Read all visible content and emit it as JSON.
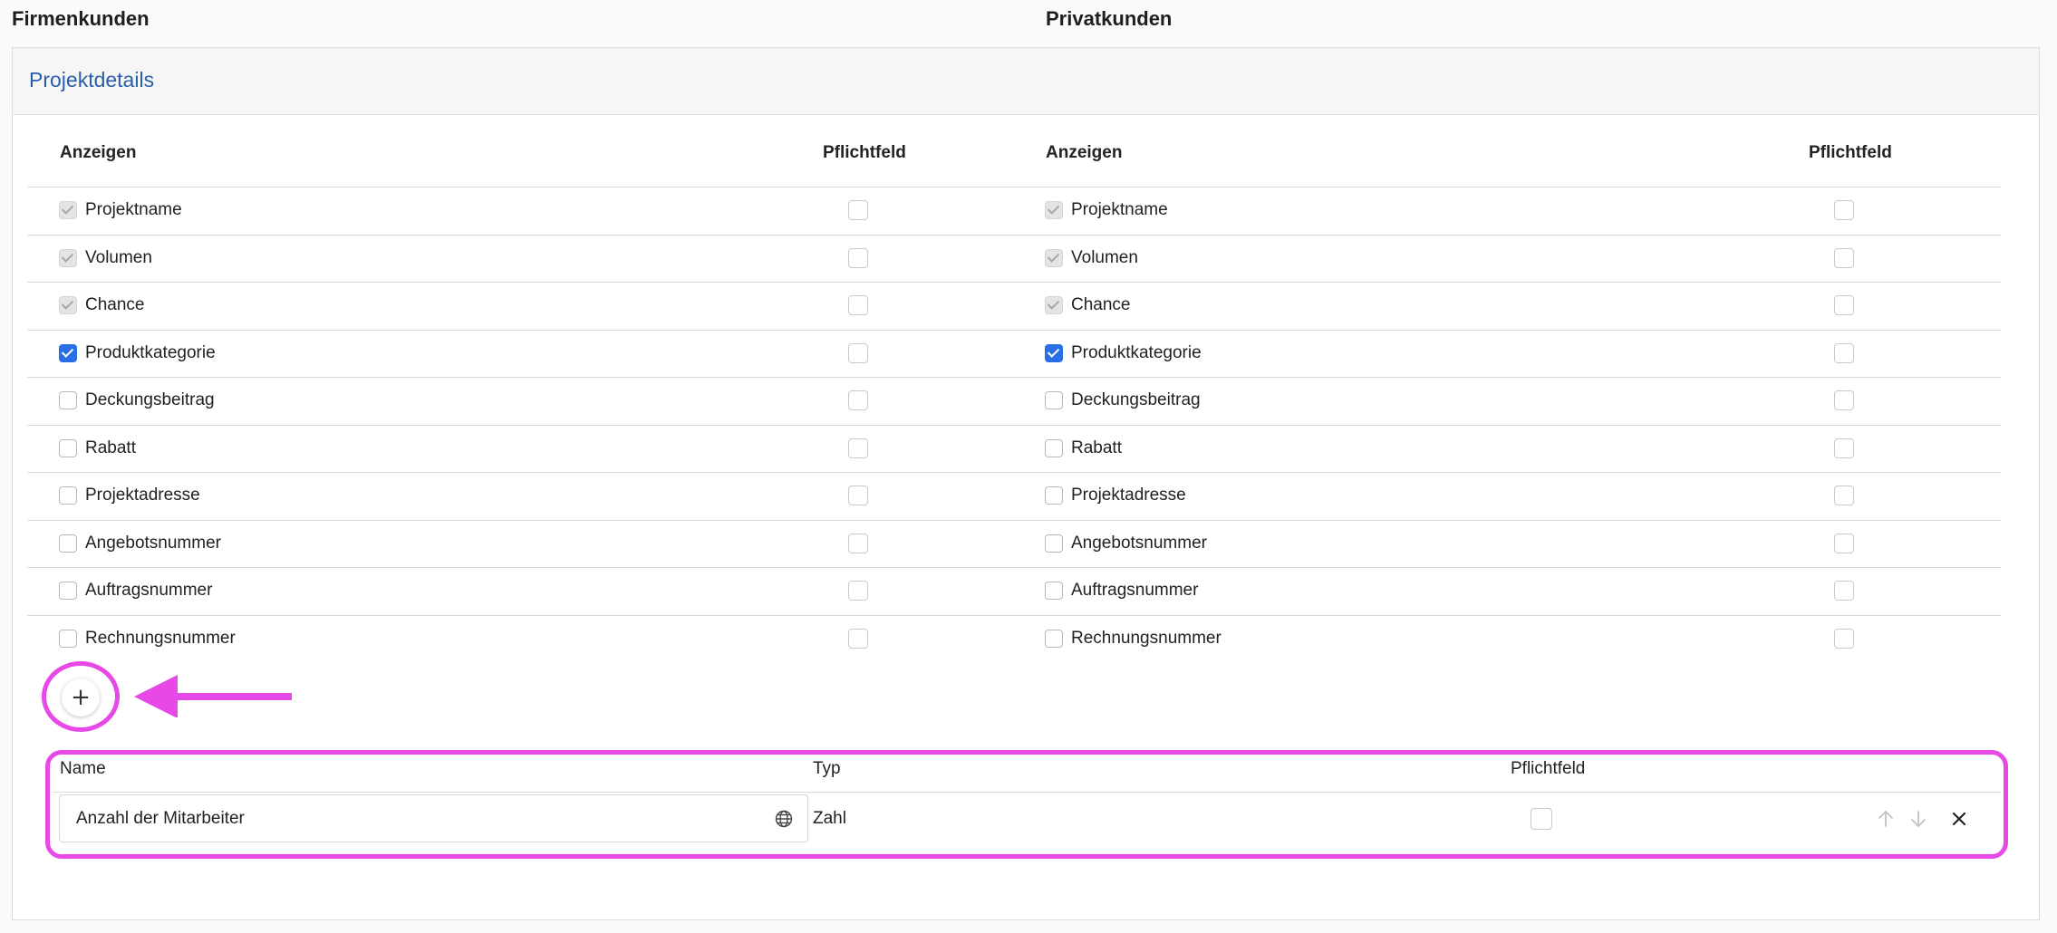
{
  "columns": {
    "business_title": "Firmenkunden",
    "private_title": "Privatkunden"
  },
  "section": {
    "title": "Projektdetails"
  },
  "table": {
    "header_show": "Anzeigen",
    "header_required": "Pflichtfeld"
  },
  "business_fields": [
    {
      "label": "Projektname",
      "show": "locked",
      "required": false
    },
    {
      "label": "Volumen",
      "show": "locked",
      "required": false
    },
    {
      "label": "Chance",
      "show": "locked",
      "required": false
    },
    {
      "label": "Produktkategorie",
      "show": "checked",
      "required": false
    },
    {
      "label": "Deckungsbeitrag",
      "show": "unchecked",
      "required": false
    },
    {
      "label": "Rabatt",
      "show": "unchecked",
      "required": false
    },
    {
      "label": "Projektadresse",
      "show": "unchecked",
      "required": false
    },
    {
      "label": "Angebotsnummer",
      "show": "unchecked",
      "required": false
    },
    {
      "label": "Auftragsnummer",
      "show": "unchecked",
      "required": false
    },
    {
      "label": "Rechnungsnummer",
      "show": "unchecked",
      "required": false
    }
  ],
  "private_fields": [
    {
      "label": "Projektname",
      "show": "locked",
      "required": false
    },
    {
      "label": "Volumen",
      "show": "locked",
      "required": false
    },
    {
      "label": "Chance",
      "show": "locked",
      "required": false
    },
    {
      "label": "Produktkategorie",
      "show": "checked",
      "required": false
    },
    {
      "label": "Deckungsbeitrag",
      "show": "unchecked",
      "required": false
    },
    {
      "label": "Rabatt",
      "show": "unchecked",
      "required": false
    },
    {
      "label": "Projektadresse",
      "show": "unchecked",
      "required": false
    },
    {
      "label": "Angebotsnummer",
      "show": "unchecked",
      "required": false
    },
    {
      "label": "Auftragsnummer",
      "show": "unchecked",
      "required": false
    },
    {
      "label": "Rechnungsnummer",
      "show": "unchecked",
      "required": false
    }
  ],
  "add_button": {
    "label": "+"
  },
  "custom_fields": {
    "header_name": "Name",
    "header_type": "Typ",
    "header_required": "Pflichtfeld",
    "rows": [
      {
        "name": "Anzahl der Mitarbeiter",
        "type": "Zahl",
        "required": false
      }
    ]
  },
  "annotation": {
    "color": "#e649e6"
  },
  "colors": {
    "accent": "#2a6ee6",
    "title": "#2a5ea8"
  }
}
